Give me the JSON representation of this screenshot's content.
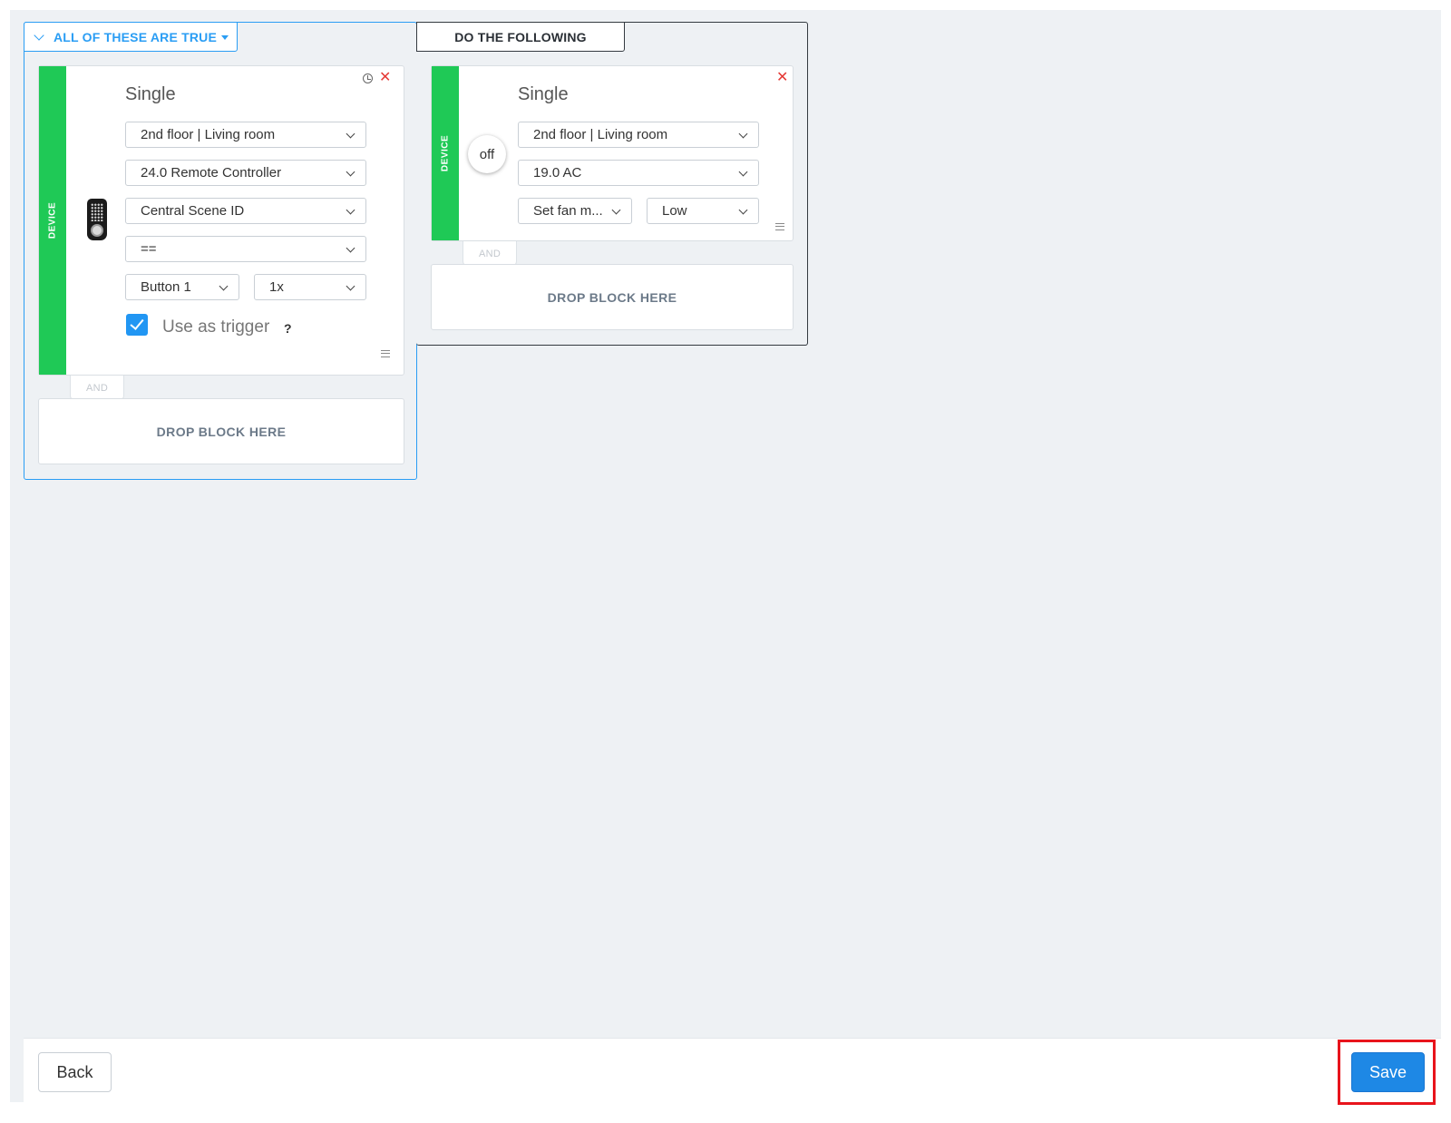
{
  "conditions": {
    "header_label": "ALL OF THESE ARE TRUE",
    "block": {
      "strip_label": "DEVICE",
      "title": "Single",
      "icon": "remote-control-icon",
      "room": "2nd floor | Living room",
      "device": "24.0 Remote Controller",
      "property": "Central Scene ID",
      "operator": "==",
      "button": "Button 1",
      "press": "1x",
      "trigger_checked": true,
      "trigger_label": "Use as trigger",
      "help": "?"
    },
    "and_label": "AND",
    "drop_label": "DROP BLOCK HERE"
  },
  "actions": {
    "header_label": "DO THE FOLLOWING",
    "block": {
      "strip_label": "DEVICE",
      "title": "Single",
      "state": "off",
      "room": "2nd floor | Living room",
      "device": "19.0 AC",
      "action": "Set fan m...",
      "value": "Low"
    },
    "and_label": "AND",
    "drop_label": "DROP BLOCK HERE"
  },
  "footer": {
    "back_label": "Back",
    "save_label": "Save"
  },
  "colors": {
    "accent": "#2a9df4",
    "device_strip": "#1fc956",
    "save_button": "#1e88e5",
    "highlight": "#e8141c",
    "close": "#e53935"
  }
}
